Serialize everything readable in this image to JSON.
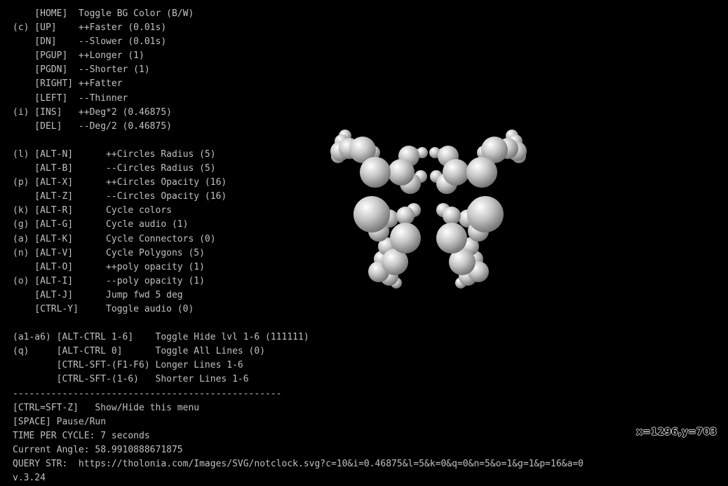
{
  "menu": {
    "lines": [
      "    [HOME]  Toggle BG Color (B/W)",
      "(c) [UP]    ++Faster (0.01s)",
      "    [DN]    --Slower (0.01s)",
      "    [PGUP]  ++Longer (1)",
      "    [PGDN]  --Shorter (1)",
      "    [RIGHT] ++Fatter",
      "    [LEFT]  --Thinner",
      "(i) [INS]   ++Deg*2 (0.46875)",
      "    [DEL]   --Deg/2 (0.46875)",
      "",
      "(l) [ALT-N]      ++Circles Radius (5)",
      "    [ALT-B]      --Circles Radius (5)",
      "(p) [ALT-X]      ++Circles Opacity (16)",
      "    [ALT-Z]      --Circles Opacity (16)",
      "(k) [ALT-R]      Cycle colors",
      "(g) [ALT-G]      Cycle audio (1)",
      "(a) [ALT-K]      Cycle Connectors (0)",
      "(n) [ALT-V]      Cycle Polygons (5)",
      "    [ALT-O]      ++poly opacity (1)",
      "(o) [ALT-I]      --poly opacity (1)",
      "    [ALT-J]      Jump fwd 5 deg",
      "    [CTRL-Y]     Toggle audio (0)",
      "",
      "(a1-a6) [ALT-CTRL 1-6]    Toggle Hide lvl 1-6 (111111)",
      "(q)     [ALT-CTRL 0]      Toggle All Lines (0)",
      "        [CTRL-SFT-(F1-F6) Longer Lines 1-6",
      "        [CTRL-SFT-(1-6)   Shorter Lines 1-6",
      "-------------------------------------------------",
      "[CTRL=SFT-Z]   Show/Hide this menu",
      "[SPACE] Pause/Run",
      "TIME PER CYCLE: 7 seconds",
      "Current Angle: 58.9910888671875",
      "QUERY STR:  https://tholonia.com/Images/SVG/notclock.svg?c=10&i=0.46875&l=5&k=0&q=0&n=5&o=1&g=1&p=16&a=0",
      "v.3.24"
    ]
  },
  "coordinates_readout": "x=1296,y=703",
  "colors": {
    "background": "#000000",
    "text": "#c0c0c0",
    "sphere_highlight": "#ffffff",
    "sphere_mid": "#c8c8c8",
    "sphere_shadow": "#6e6e6e"
  },
  "figure": {
    "description_icon": "sphere-cluster-icon"
  }
}
